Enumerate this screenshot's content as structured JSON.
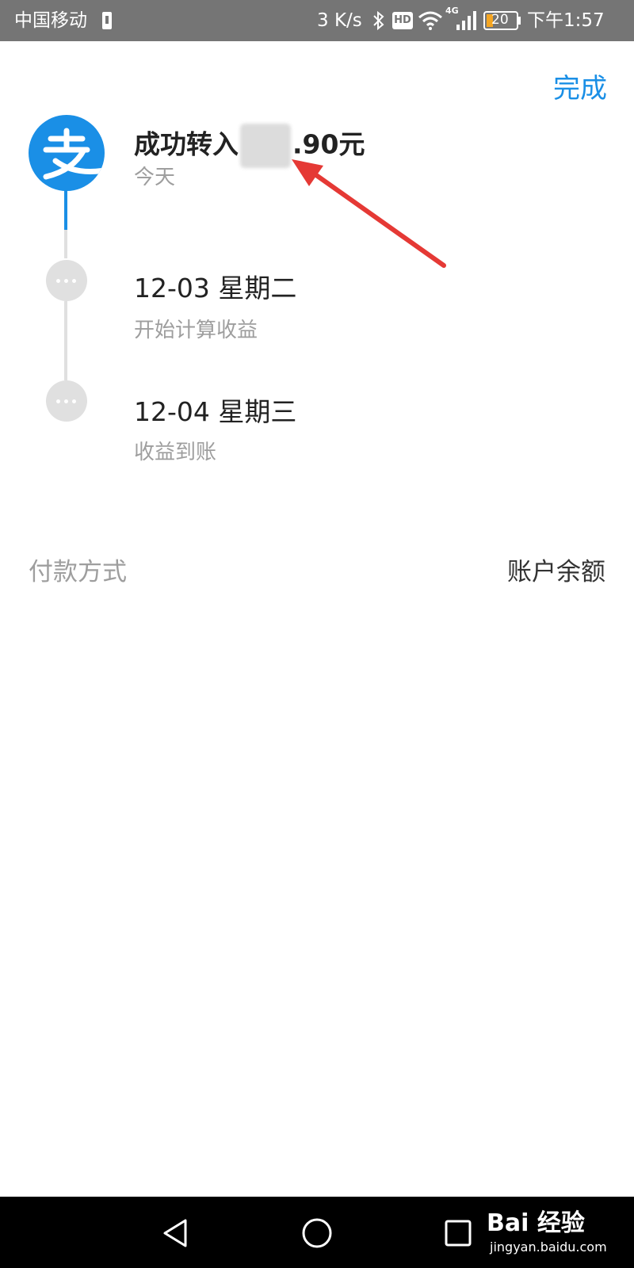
{
  "status_bar": {
    "carrier": "中国移动",
    "speed": "3 K/s",
    "hd_badge": "HD",
    "network": "4G",
    "battery_level": "20",
    "time": "下午1:57",
    "icons": [
      "sim-icon",
      "bluetooth-icon",
      "hd-icon",
      "wifi-icon",
      "signal-icon",
      "battery-icon"
    ]
  },
  "header": {
    "done_label": "完成"
  },
  "timeline": {
    "steps": [
      {
        "title_prefix": "成功转入",
        "title_suffix": ".90元",
        "subtitle": "今天",
        "icon": "alipay-logo-icon"
      },
      {
        "title": "12-03 星期二",
        "subtitle": "开始计算收益",
        "icon": "more-dots-icon"
      },
      {
        "title": "12-04 星期三",
        "subtitle": "收益到账",
        "icon": "more-dots-icon"
      }
    ]
  },
  "payment": {
    "label": "付款方式",
    "value": "账户余额"
  },
  "nav_bar": {
    "icons": [
      "back-icon",
      "home-icon",
      "recents-icon"
    ]
  },
  "watermark": {
    "brand": "Bai 经验",
    "url": "jingyan.baidu.com"
  },
  "colors": {
    "accent": "#1a8fe6",
    "status_bar_bg": "#757575",
    "arrow": "#e53935"
  }
}
